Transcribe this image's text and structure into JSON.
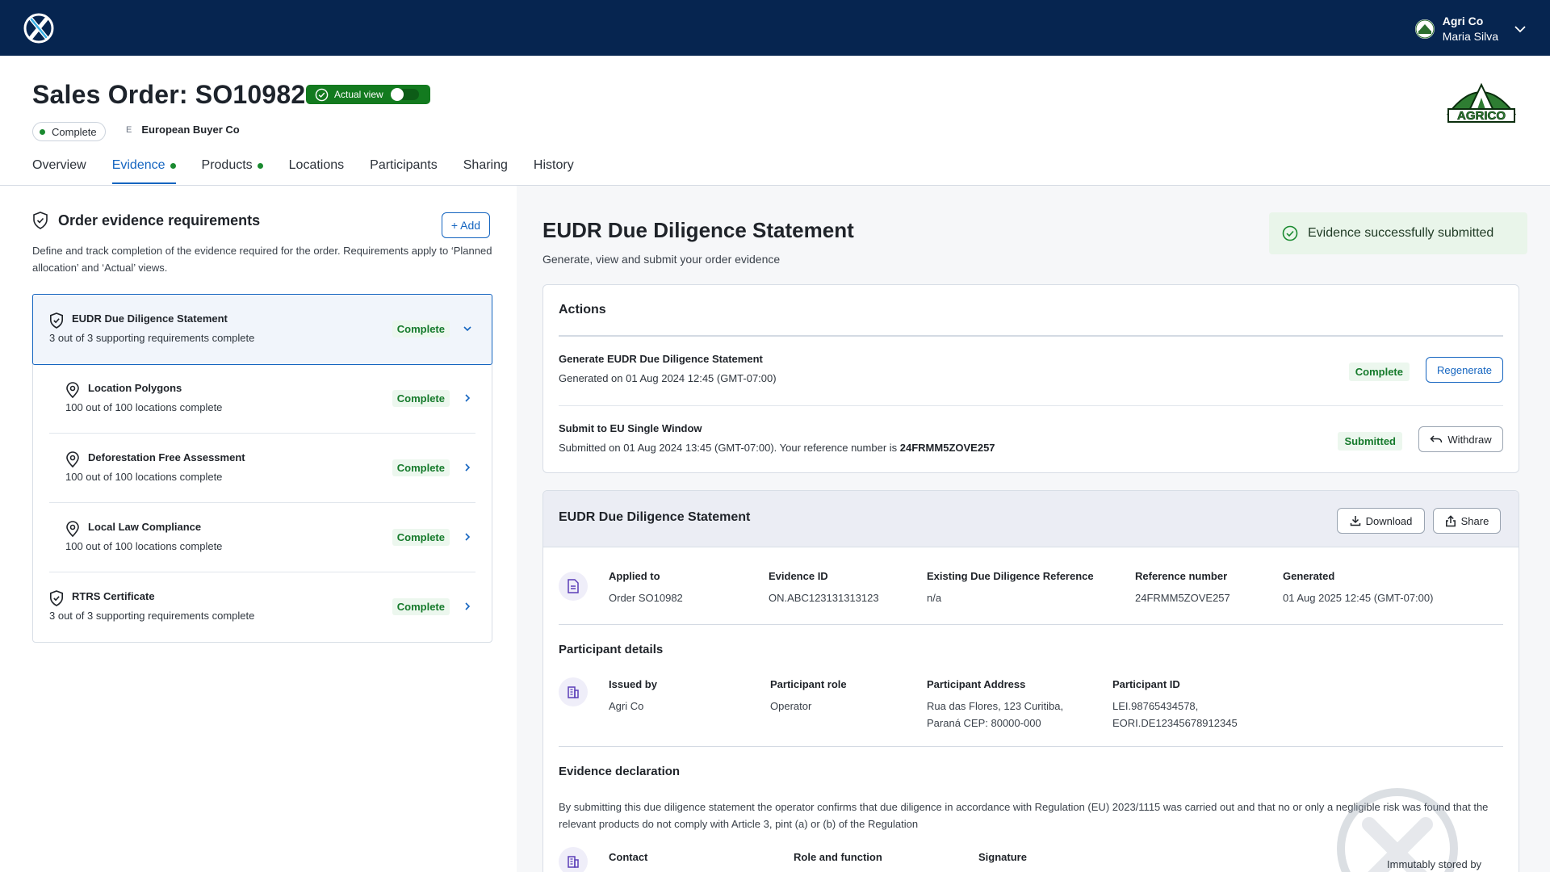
{
  "topbar": {
    "org": "Agri Co",
    "user": "Maria Silva"
  },
  "header": {
    "title": "Sales Order: SO10982",
    "view_toggle_label": "Actual view",
    "status": "Complete",
    "buyer_initial": "E",
    "buyer": "European Buyer Co",
    "brand_logo_text": "AGRICO"
  },
  "tabs": [
    {
      "label": "Overview"
    },
    {
      "label": "Evidence"
    },
    {
      "label": "Products"
    },
    {
      "label": "Locations"
    },
    {
      "label": "Participants"
    },
    {
      "label": "Sharing"
    },
    {
      "label": "History"
    }
  ],
  "requirements": {
    "title": "Order evidence requirements",
    "add_label": "+ Add",
    "description": "Define and track completion of the evidence required for the order. Requirements apply to ‘Planned allocation’ and ‘Actual’ views.",
    "items": [
      {
        "name": "EUDR Due Diligence Statement",
        "detail": "3 out of 3 supporting requirements complete",
        "status": "Complete"
      },
      {
        "name": "Location Polygons",
        "detail": "100 out of 100 locations complete",
        "status": "Complete"
      },
      {
        "name": "Deforestation Free Assessment",
        "detail": "100 out of 100 locations complete",
        "status": "Complete"
      },
      {
        "name": "Local Law Compliance",
        "detail": "100 out of 100 locations complete",
        "status": "Complete"
      },
      {
        "name": "RTRS Certificate",
        "detail": "3 out of 3 supporting requirements complete",
        "status": "Complete"
      }
    ]
  },
  "main": {
    "title": "EUDR Due Diligence Statement",
    "subtitle": "Generate, view and submit your order evidence",
    "toast": "Evidence successfully submitted"
  },
  "actions": {
    "title": "Actions",
    "rows": [
      {
        "name": "Generate EUDR Due Diligence Statement",
        "desc": "Generated on 01 Aug 2024 12:45 (GMT-07:00)",
        "status": "Complete",
        "button": "Regenerate"
      },
      {
        "name": "Submit to EU Single Window",
        "desc": "Submitted on  01 Aug 2024 13:45 (GMT-07:00). Your reference number is ",
        "ref": "24FRMM5ZOVE257",
        "status": "Submitted",
        "button": "Withdraw"
      }
    ]
  },
  "statement": {
    "title": "EUDR Due Diligence Statement",
    "download": "Download",
    "share": "Share",
    "fields": [
      {
        "label": "Applied to",
        "value": "Order SO10982"
      },
      {
        "label": "Evidence ID",
        "value": "ON.ABC123131313123"
      },
      {
        "label": "Existing Due Diligence Reference",
        "value": "n/a"
      },
      {
        "label": "Reference number",
        "value": "24FRMM5ZOVE257"
      },
      {
        "label": "Generated",
        "value": "01 Aug 2025 12:45 (GMT-07:00)"
      }
    ],
    "participant_title": "Participant details",
    "participant": [
      {
        "label": "Issued by",
        "value": "Agri Co"
      },
      {
        "label": "Participant role",
        "value": "Operator"
      },
      {
        "label": "Participant Address",
        "value": "Rua das Flores, 123 Curitiba,",
        "value2": "Paraná CEP: 80000-000"
      },
      {
        "label": "Participant ID",
        "value": "LEI.98765434578,",
        "value2": "EORI.DE12345678912345"
      }
    ],
    "declaration_title": "Evidence declaration",
    "declaration": "By submitting this due diligence statement the operator confirms that due diligence in accordance with Regulation (EU) 2023/1115 was carried out and that no or only a negligible risk was found that the relevant products do not comply with Article 3, pint (a) or (b) of the Regulation",
    "contact_fields": [
      {
        "label": "Contact"
      },
      {
        "label": "Role and function"
      },
      {
        "label": "Signature"
      }
    ],
    "immutable": "Immutably stored by"
  }
}
